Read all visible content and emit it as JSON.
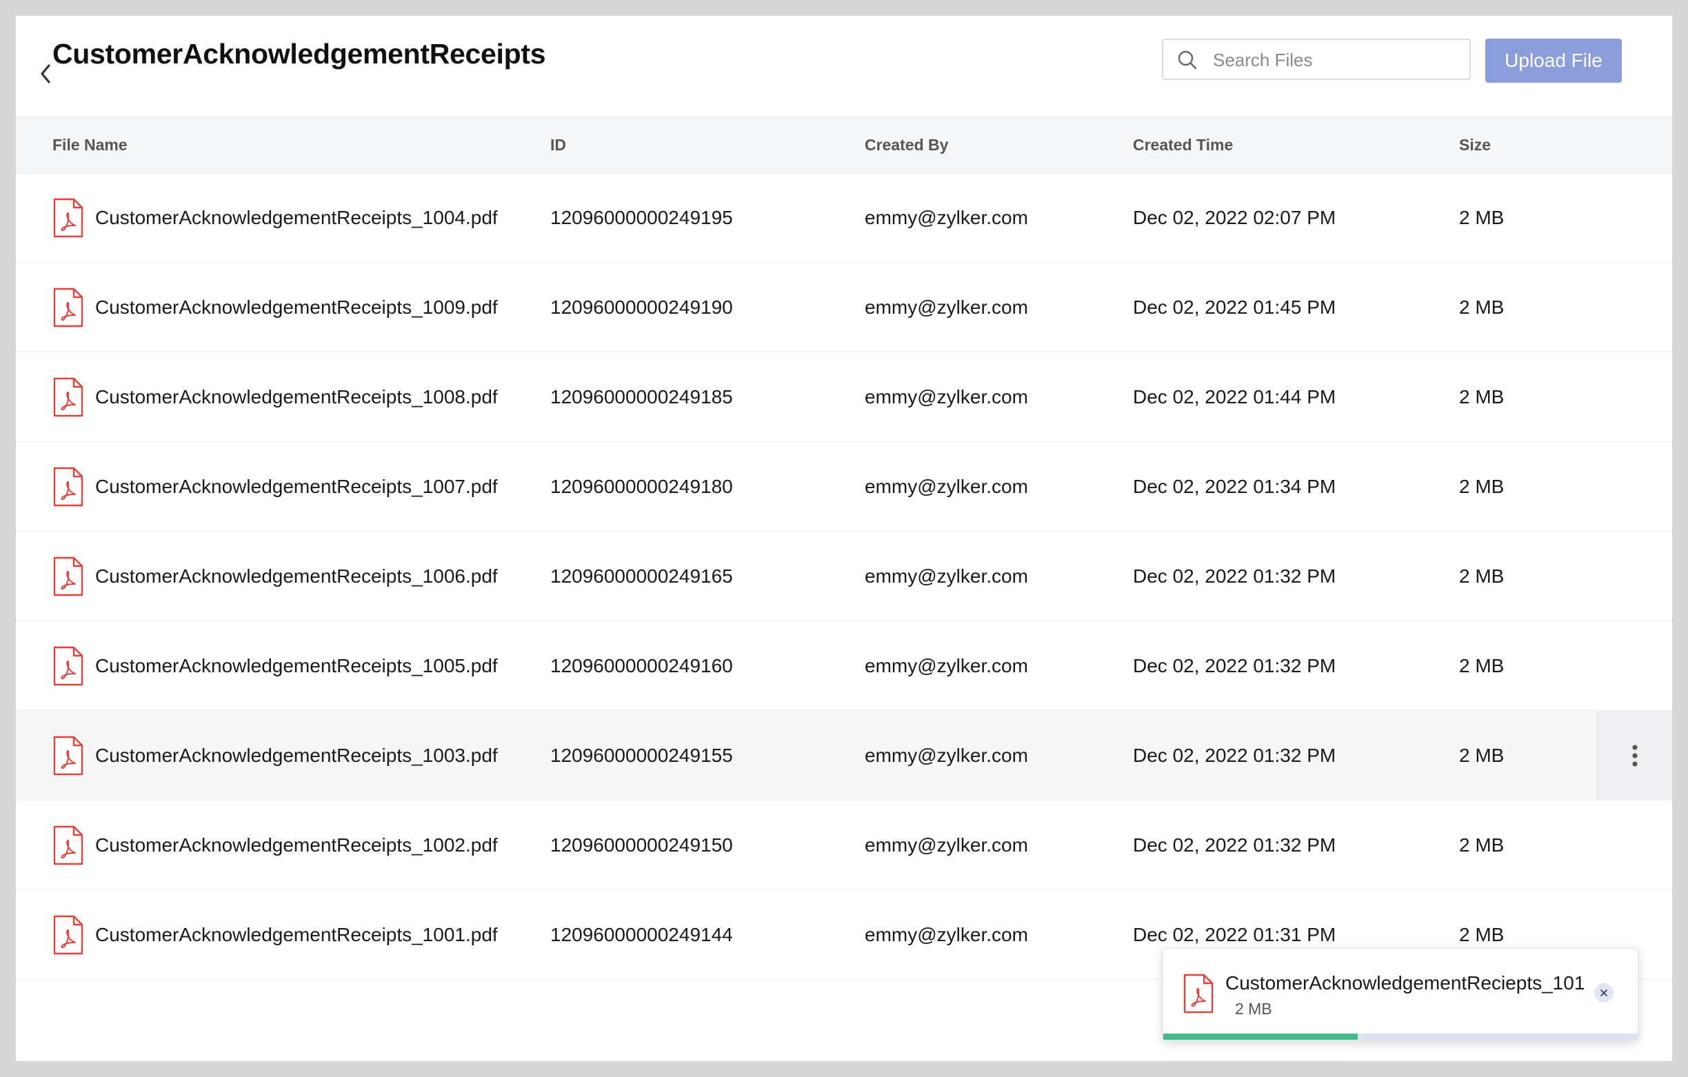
{
  "page": {
    "title": "CustomerAcknowledgementReceipts"
  },
  "search": {
    "placeholder": "Search Files",
    "value": ""
  },
  "toolbar": {
    "upload_label": "Upload File"
  },
  "table": {
    "columns": [
      "File Name",
      "ID",
      "Created By",
      "Created Time",
      "Size"
    ],
    "rows": [
      {
        "name": "CustomerAcknowledgementReceipts_1004.pdf",
        "id": "12096000000249195",
        "created_by": "emmy@zylker.com",
        "created_time": "Dec 02, 2022 02:07 PM",
        "size": "2 MB"
      },
      {
        "name": "CustomerAcknowledgementReceipts_1009.pdf",
        "id": "12096000000249190",
        "created_by": "emmy@zylker.com",
        "created_time": "Dec 02, 2022 01:45 PM",
        "size": "2 MB"
      },
      {
        "name": "CustomerAcknowledgementReceipts_1008.pdf",
        "id": "12096000000249185",
        "created_by": "emmy@zylker.com",
        "created_time": "Dec 02, 2022 01:44 PM",
        "size": "2 MB"
      },
      {
        "name": "CustomerAcknowledgementReceipts_1007.pdf",
        "id": "12096000000249180",
        "created_by": "emmy@zylker.com",
        "created_time": "Dec 02, 2022 01:34 PM",
        "size": "2 MB"
      },
      {
        "name": "CustomerAcknowledgementReceipts_1006.pdf",
        "id": "12096000000249165",
        "created_by": "emmy@zylker.com",
        "created_time": "Dec 02, 2022 01:32 PM",
        "size": "2 MB"
      },
      {
        "name": "CustomerAcknowledgementReceipts_1005.pdf",
        "id": "12096000000249160",
        "created_by": "emmy@zylker.com",
        "created_time": "Dec 02, 2022 01:32 PM",
        "size": "2 MB"
      },
      {
        "name": "CustomerAcknowledgementReceipts_1003.pdf",
        "id": "12096000000249155",
        "created_by": "emmy@zylker.com",
        "created_time": "Dec 02, 2022 01:32 PM",
        "size": "2 MB",
        "hovered": true
      },
      {
        "name": "CustomerAcknowledgementReceipts_1002.pdf",
        "id": "12096000000249150",
        "created_by": "emmy@zylker.com",
        "created_time": "Dec 02, 2022 01:32 PM",
        "size": "2 MB"
      },
      {
        "name": "CustomerAcknowledgementReceipts_1001.pdf",
        "id": "12096000000249144",
        "created_by": "emmy@zylker.com",
        "created_time": "Dec 02, 2022 01:31 PM",
        "size": "2 MB"
      }
    ]
  },
  "upload_toast": {
    "file_name": "CustomerAcknowledgementReciepts_101...",
    "size": "2 MB",
    "progress": 0.41
  },
  "icons": {
    "back": "chevron-left-icon",
    "search": "search-icon",
    "file": "pdf-file-icon",
    "row_menu": "more-vertical-icon",
    "close": "close-icon"
  },
  "colors": {
    "upload_button": "#8c9ed9",
    "pdf_icon": "#e0423a",
    "progress_fill": "#46b98a",
    "progress_track": "#dde3f1",
    "header_bg": "#f6f7f9"
  }
}
